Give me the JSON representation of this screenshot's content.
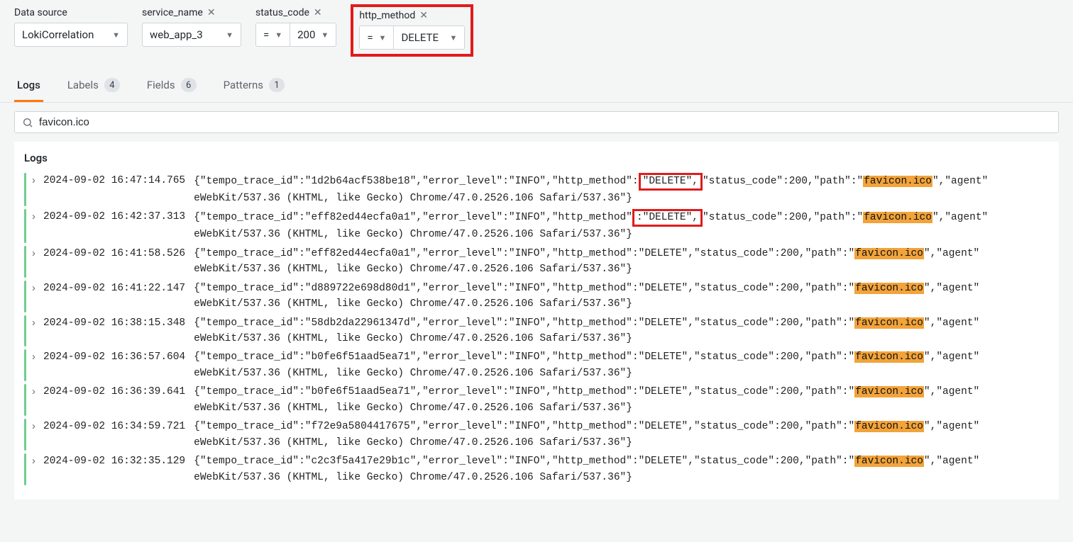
{
  "filters": {
    "datasource": {
      "label": "Data source",
      "value": "LokiCorrelation"
    },
    "service_name": {
      "label": "service_name",
      "value": "web_app_3"
    },
    "status_code": {
      "label": "status_code",
      "op": "=",
      "value": "200"
    },
    "http_method": {
      "label": "http_method",
      "op": "=",
      "value": "DELETE"
    }
  },
  "tabs": {
    "logs": {
      "label": "Logs"
    },
    "labels": {
      "label": "Labels",
      "count": "4"
    },
    "fields": {
      "label": "Fields",
      "count": "6"
    },
    "patterns": {
      "label": "Patterns",
      "count": "1"
    }
  },
  "search": {
    "value": "favicon.ico"
  },
  "logs_panel": {
    "title": "Logs",
    "highlight_term": "favicon.ico",
    "line2_suffix": "eWebKit/537.36 (KHTML, like Gecko) Chrome/47.0.2526.106 Safari/537.36\"}",
    "rows": [
      {
        "ts": "2024-09-02 16:47:14.765",
        "trace": "1d2b64acf538be18",
        "red_delete": true
      },
      {
        "ts": "2024-09-02 16:42:37.313",
        "trace": "eff82ed44ecfa0a1",
        "red_delete_alt": true
      },
      {
        "ts": "2024-09-02 16:41:58.526",
        "trace": "eff82ed44ecfa0a1"
      },
      {
        "ts": "2024-09-02 16:41:22.147",
        "trace": "d889722e698d80d1"
      },
      {
        "ts": "2024-09-02 16:38:15.348",
        "trace": "58db2da22961347d"
      },
      {
        "ts": "2024-09-02 16:36:57.604",
        "trace": "b0fe6f51aad5ea71"
      },
      {
        "ts": "2024-09-02 16:36:39.641",
        "trace": "b0fe6f51aad5ea71"
      },
      {
        "ts": "2024-09-02 16:34:59.721",
        "trace": "f72e9a5804417675"
      },
      {
        "ts": "2024-09-02 16:32:35.129",
        "trace": "c2c3f5a417e29b1c"
      }
    ]
  }
}
